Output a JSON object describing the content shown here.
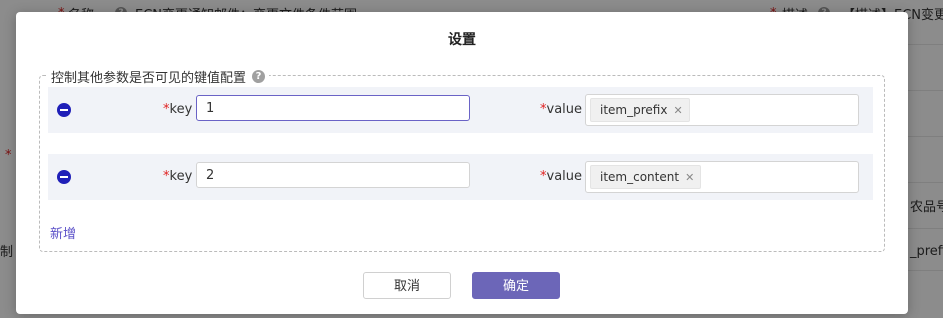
{
  "background": {
    "name_label": "名称",
    "name_value": "ECN变更通知邮件：变更文件条件范围",
    "desc_label": "描述",
    "desc_value": "【描述】ECN变更",
    "left_fragment": "制",
    "right_fragment_1": "农品号",
    "right_fragment_2": "_prefix"
  },
  "dialog": {
    "title": "设置",
    "section_label": "控制其他参数是否可见的键值配置",
    "key_label": "key",
    "value_label": "value",
    "rows": [
      {
        "key": "1",
        "tags": [
          "item_prefix"
        ]
      },
      {
        "key": "2",
        "tags": [
          "item_content"
        ]
      }
    ],
    "add_label": "新增",
    "cancel_label": "取消",
    "ok_label": "确定",
    "icons": {
      "help": "question-icon",
      "remove": "minus-circle-icon",
      "tag_close": "close-icon"
    },
    "colors": {
      "primary": "#6c66b8",
      "remove": "#1f1fb8",
      "link": "#5b50c8",
      "required": "#e02020"
    }
  }
}
